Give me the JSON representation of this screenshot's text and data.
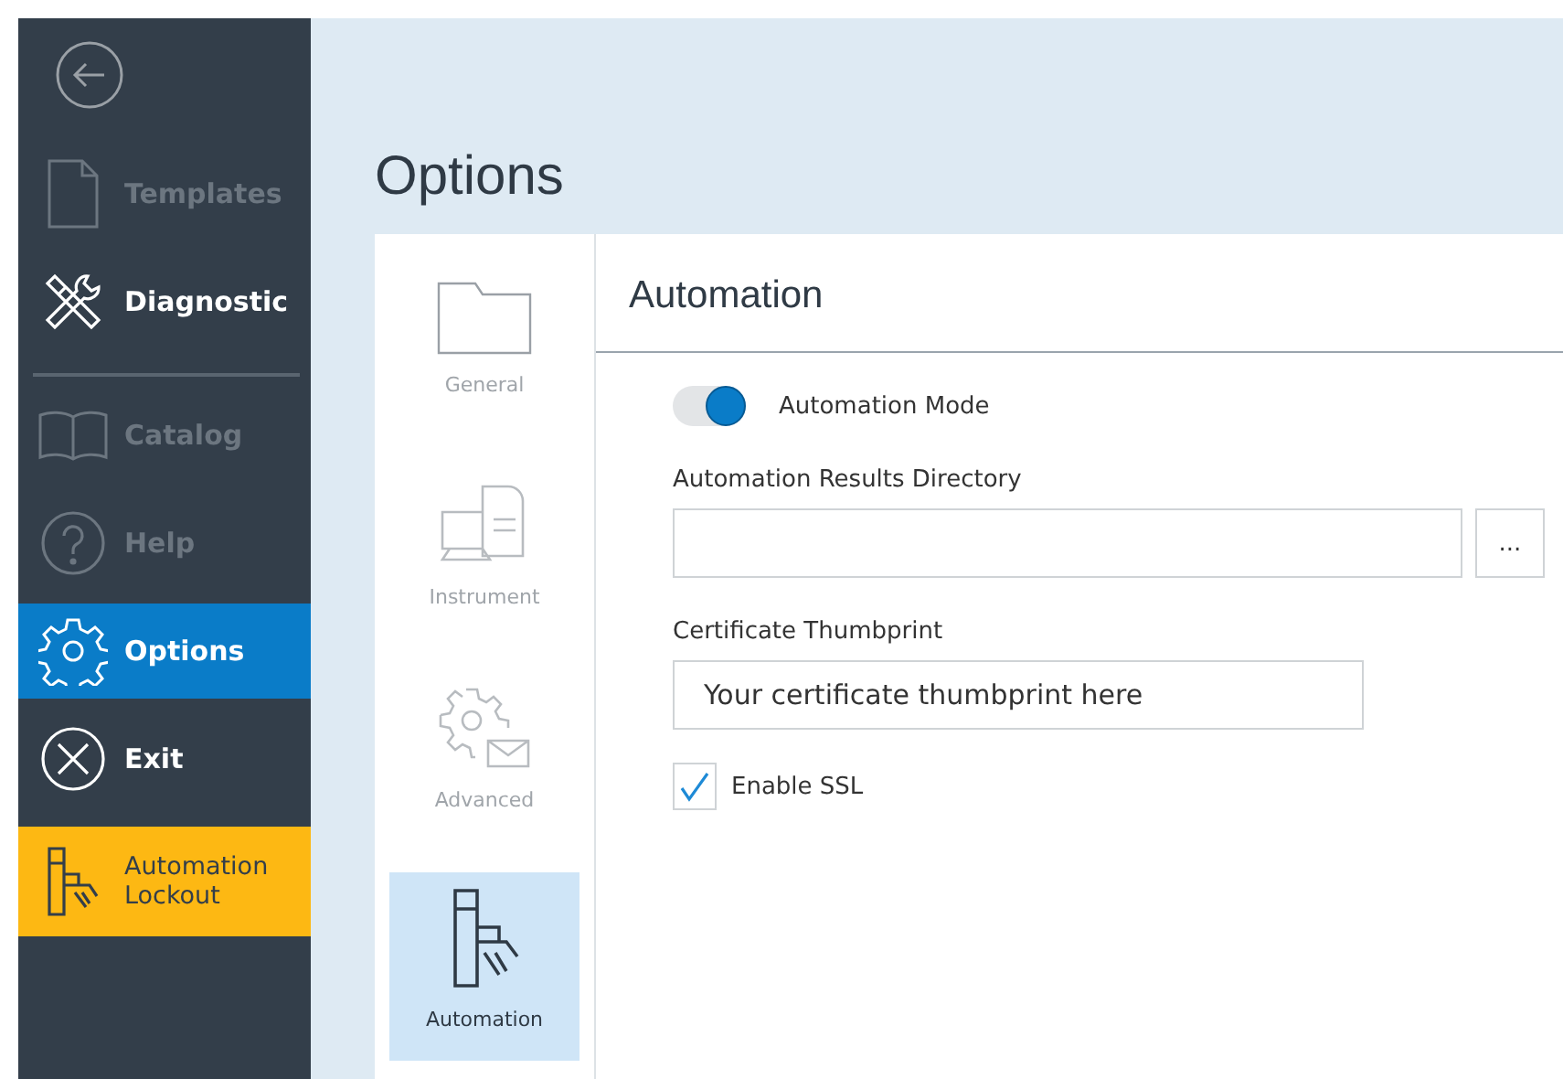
{
  "sidebar": {
    "items": [
      {
        "label": "Templates",
        "kind": "nav",
        "disabled": true,
        "selected": false
      },
      {
        "label": "Diagnostic",
        "kind": "nav",
        "disabled": false,
        "selected": false
      },
      {
        "label": "Catalog",
        "kind": "nav",
        "disabled": true,
        "selected": false
      },
      {
        "label": "Help",
        "kind": "nav",
        "disabled": true,
        "selected": false
      },
      {
        "label": "Options",
        "kind": "nav",
        "disabled": false,
        "selected": true
      },
      {
        "label": "Exit",
        "kind": "nav",
        "disabled": false,
        "selected": false
      },
      {
        "label": "Automation Lockout",
        "kind": "alert",
        "disabled": false,
        "selected": false
      }
    ]
  },
  "page_title": "Options",
  "categories": [
    {
      "label": "General",
      "selected": false
    },
    {
      "label": "Instrument",
      "selected": false
    },
    {
      "label": "Advanced",
      "selected": false
    },
    {
      "label": "Automation",
      "selected": true
    }
  ],
  "section_title": "Automation",
  "automation_mode": {
    "label": "Automation Mode",
    "on": true
  },
  "results_directory": {
    "label": "Automation Results Directory",
    "browse_button": "..."
  },
  "certificate_thumbprint": {
    "label": "Certificate Thumbprint",
    "value": "Your certificate thumbprint here"
  },
  "enable_ssl": {
    "label": "Enable SSL",
    "checked": true
  }
}
